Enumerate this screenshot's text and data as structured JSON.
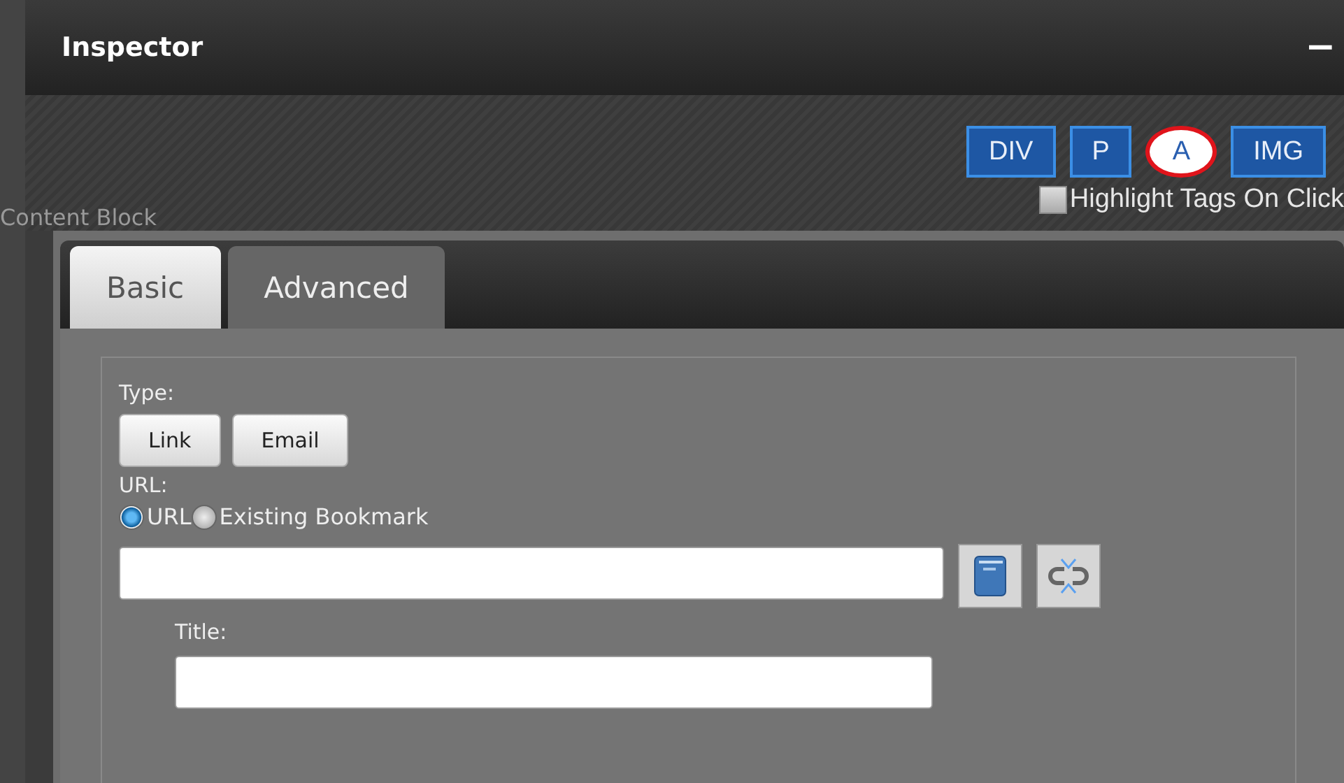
{
  "window": {
    "title": "Inspector",
    "minimize": "−"
  },
  "background": {
    "heading": "Content Block"
  },
  "tags": [
    {
      "label": "DIV",
      "selected": false
    },
    {
      "label": "P",
      "selected": false
    },
    {
      "label": "A",
      "selected": true
    },
    {
      "label": "IMG",
      "selected": false
    }
  ],
  "highlight_option": {
    "label": "Highlight Tags On Click",
    "checked": false
  },
  "tabs": [
    {
      "label": "Basic",
      "selected": true
    },
    {
      "label": "Advanced",
      "selected": false
    }
  ],
  "type": {
    "label": "Type:",
    "buttons": [
      "Link",
      "Email"
    ]
  },
  "url": {
    "label": "URL:",
    "options": [
      {
        "label": "URL",
        "selected": true
      },
      {
        "label": "Existing Bookmark",
        "selected": false
      }
    ]
  },
  "title_field": {
    "label": "Title:"
  }
}
